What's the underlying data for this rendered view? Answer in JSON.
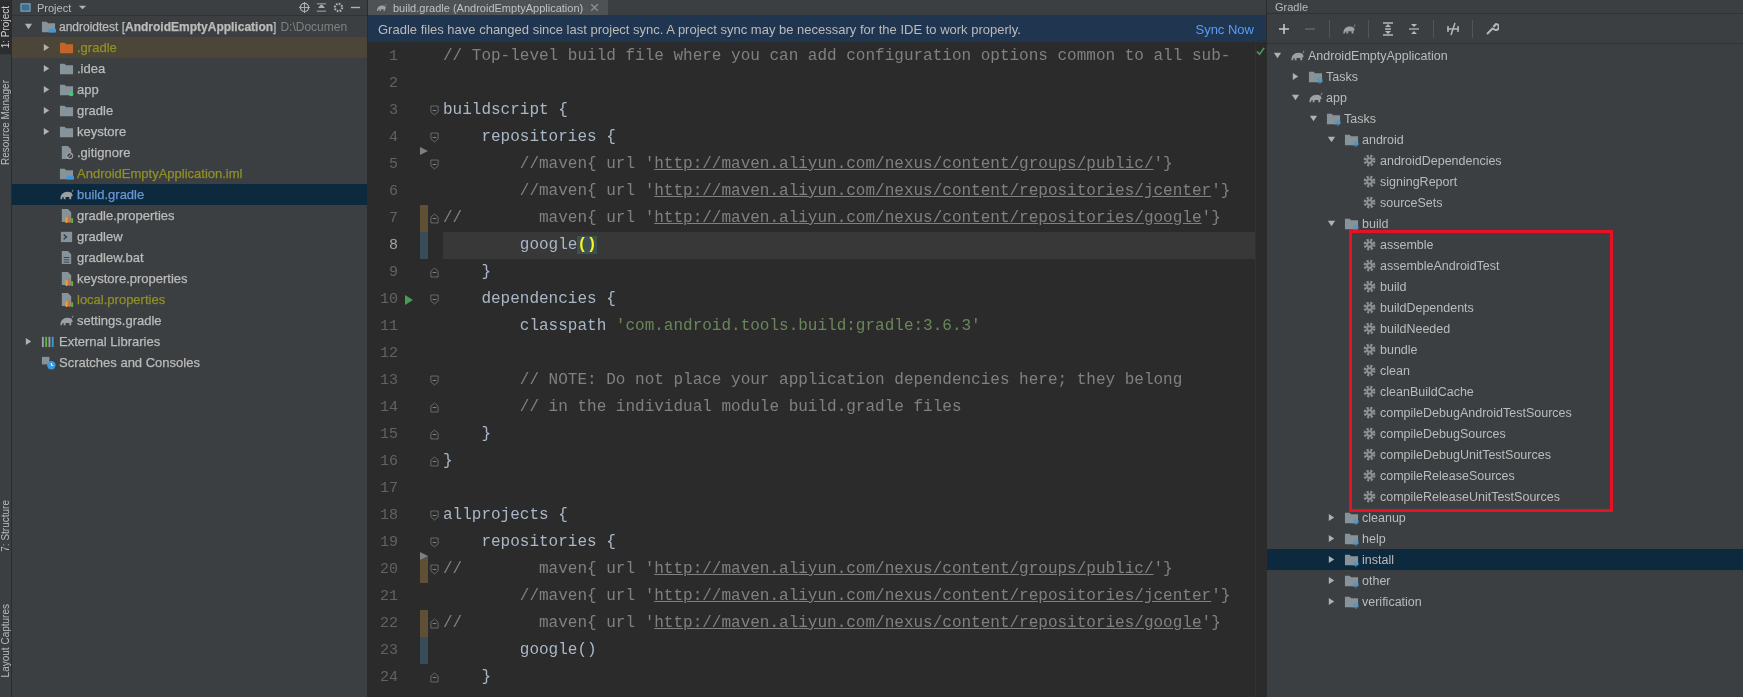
{
  "tool_stripe": {
    "top": [
      {
        "label": "1: Project",
        "selected": true
      },
      {
        "label": "Resource Manager",
        "selected": false
      }
    ],
    "bottom": [
      {
        "label": "7: Structure",
        "selected": false
      },
      {
        "label": "Layout Captures",
        "selected": false
      }
    ]
  },
  "project": {
    "title": "Project",
    "tree": [
      {
        "label": "androidtest [**AndroidEmptyApplication**]",
        "location": "D:\\Documen",
        "kind": "project-root",
        "color": "#bbbbbb",
        "selected": false,
        "expanded": true,
        "children": [
          {
            "label": ".gradle",
            "kind": "excluded-folder",
            "color": "#8f9027",
            "selected": false,
            "highlighted": true,
            "expanded": false
          },
          {
            "label": ".idea",
            "kind": "folder",
            "color": "#bbbbbb",
            "selected": false,
            "expanded": false
          },
          {
            "label": "app",
            "kind": "module-folder",
            "color": "#bbbbbb",
            "selected": false,
            "expanded": false
          },
          {
            "label": "gradle",
            "kind": "folder",
            "color": "#bbbbbb",
            "selected": false,
            "expanded": false
          },
          {
            "label": "keystore",
            "kind": "folder",
            "color": "#bbbbbb",
            "selected": false,
            "expanded": false
          },
          {
            "label": ".gitignore",
            "kind": "ignore-file",
            "color": "#bbbbbb",
            "selected": false
          },
          {
            "label": "AndroidEmptyApplication.iml",
            "kind": "module-file",
            "color": "#8f9027",
            "selected": false
          },
          {
            "label": "build.gradle",
            "kind": "gradle-file",
            "color": "#6897d0",
            "selected": true
          },
          {
            "label": "gradle.properties",
            "kind": "properties-file",
            "color": "#bbbbbb",
            "selected": false
          },
          {
            "label": "gradlew",
            "kind": "script-file",
            "color": "#bbbbbb",
            "selected": false
          },
          {
            "label": "gradlew.bat",
            "kind": "text-file",
            "color": "#bbbbbb",
            "selected": false
          },
          {
            "label": "keystore.properties",
            "kind": "properties-file",
            "color": "#bbbbbb",
            "selected": false
          },
          {
            "label": "local.properties",
            "kind": "properties-file",
            "color": "#8f9027",
            "selected": false
          },
          {
            "label": "settings.gradle",
            "kind": "gradle-file",
            "color": "#bbbbbb",
            "selected": false
          }
        ]
      },
      {
        "label": "External Libraries",
        "kind": "libraries",
        "color": "#bbbbbb",
        "selected": false,
        "expanded": false
      },
      {
        "label": "Scratches and Consoles",
        "kind": "scratches",
        "color": "#bbbbbb",
        "selected": false
      }
    ]
  },
  "editor": {
    "tab": {
      "label": "build.gradle (AndroidEmptyApplication)",
      "selected": true
    },
    "notification": {
      "message": "Gradle files have changed since last project sync. A project sync may be necessary for the IDE to work properly.",
      "action": "Sync Now"
    },
    "lines": [
      {
        "number": "1",
        "tokens": [
          {
            "text": "// Top-level build file where you can add configuration options common to all sub-",
            "kind": "comment"
          }
        ]
      },
      {
        "number": "2"
      },
      {
        "number": "3",
        "fold_start": true,
        "tokens": [
          {
            "text": "buildscript {",
            "kind": "plain"
          }
        ]
      },
      {
        "number": "4",
        "fold_start": true,
        "tokens": [
          {
            "text": "    repositories {",
            "kind": "plain"
          }
        ]
      },
      {
        "number": "5",
        "fold_start": true,
        "deleted_above": true,
        "tokens": [
          {
            "text": "        //maven{ url '",
            "kind": "comment"
          },
          {
            "text": "http://maven.aliyun.com/nexus/content/groups/public/",
            "kind": "link"
          },
          {
            "text": "'}",
            "kind": "comment"
          }
        ]
      },
      {
        "number": "6",
        "tokens": [
          {
            "text": "        //maven{ url '",
            "kind": "comment"
          },
          {
            "text": "http://maven.aliyun.com/nexus/content/repositories/jcenter",
            "kind": "link"
          },
          {
            "text": "'}",
            "kind": "comment"
          }
        ]
      },
      {
        "number": "7",
        "fold_end": true,
        "modified": true,
        "tokens": [
          {
            "text": "//        maven{ url '",
            "kind": "comment"
          },
          {
            "text": "http://maven.aliyun.com/nexus/content/repositories/google",
            "kind": "link"
          },
          {
            "text": "'}",
            "kind": "comment"
          }
        ]
      },
      {
        "number": "8",
        "current": true,
        "added": true,
        "tokens": [
          {
            "text": "        google",
            "kind": "plain"
          },
          {
            "text": "()",
            "kind": "match"
          }
        ]
      },
      {
        "number": "9",
        "fold_end": true,
        "tokens": [
          {
            "text": "    }",
            "kind": "plain"
          }
        ]
      },
      {
        "number": "10",
        "fold_start": true,
        "run": true,
        "tokens": [
          {
            "text": "    dependencies {",
            "kind": "plain"
          }
        ]
      },
      {
        "number": "11",
        "tokens": [
          {
            "text": "        classpath ",
            "kind": "plain"
          },
          {
            "text": "'com.android.tools.build:gradle:3.6.3'",
            "kind": "string"
          }
        ]
      },
      {
        "number": "12"
      },
      {
        "number": "13",
        "fold_start": true,
        "tokens": [
          {
            "text": "        // NOTE: Do not place your application dependencies here; they belong",
            "kind": "comment"
          }
        ]
      },
      {
        "number": "14",
        "fold_end": true,
        "tokens": [
          {
            "text": "        // in the individual module build.gradle files",
            "kind": "comment"
          }
        ]
      },
      {
        "number": "15",
        "fold_end": true,
        "tokens": [
          {
            "text": "    }",
            "kind": "plain"
          }
        ]
      },
      {
        "number": "16",
        "fold_end": true,
        "tokens": [
          {
            "text": "}",
            "kind": "plain"
          }
        ]
      },
      {
        "number": "17"
      },
      {
        "number": "18",
        "fold_start": true,
        "tokens": [
          {
            "text": "allprojects {",
            "kind": "plain"
          }
        ]
      },
      {
        "number": "19",
        "fold_start": true,
        "tokens": [
          {
            "text": "    repositories {",
            "kind": "plain"
          }
        ]
      },
      {
        "number": "20",
        "fold_start": true,
        "modified": true,
        "deleted_above": true,
        "tokens": [
          {
            "text": "//        maven{ url '",
            "kind": "comment"
          },
          {
            "text": "http://maven.aliyun.com/nexus/content/groups/public/",
            "kind": "link"
          },
          {
            "text": "'}",
            "kind": "comment"
          }
        ]
      },
      {
        "number": "21",
        "tokens": [
          {
            "text": "        //maven{ url '",
            "kind": "comment"
          },
          {
            "text": "http://maven.aliyun.com/nexus/content/repositories/jcenter",
            "kind": "link"
          },
          {
            "text": "'}",
            "kind": "comment"
          }
        ]
      },
      {
        "number": "22",
        "fold_end": true,
        "modified": true,
        "tokens": [
          {
            "text": "//        maven{ url '",
            "kind": "comment"
          },
          {
            "text": "http://maven.aliyun.com/nexus/content/repositories/google",
            "kind": "link"
          },
          {
            "text": "'}",
            "kind": "comment"
          }
        ]
      },
      {
        "number": "23",
        "added": true,
        "tokens": [
          {
            "text": "        google()",
            "kind": "plain"
          }
        ]
      },
      {
        "number": "24",
        "fold_end": true,
        "tokens": [
          {
            "text": "    }",
            "kind": "plain"
          }
        ]
      }
    ]
  },
  "gradle": {
    "title": "Gradle",
    "tree": [
      {
        "label": "AndroidEmptyApplication",
        "kind": "elephant",
        "selected": false,
        "expanded": true,
        "children": [
          {
            "label": "Tasks",
            "kind": "task-folder",
            "selected": false,
            "expanded": false
          },
          {
            "label": "app",
            "kind": "elephant",
            "selected": false,
            "expanded": true,
            "children": [
              {
                "label": "Tasks",
                "kind": "task-folder",
                "selected": false,
                "expanded": true,
                "children": [
                  {
                    "label": "android",
                    "kind": "task-folder",
                    "selected": false,
                    "expanded": true,
                    "children": [
                      {
                        "label": "androidDependencies",
                        "kind": "gear",
                        "selected": false
                      },
                      {
                        "label": "signingReport",
                        "kind": "gear",
                        "selected": false
                      },
                      {
                        "label": "sourceSets",
                        "kind": "gear",
                        "selected": false
                      }
                    ]
                  },
                  {
                    "label": "build",
                    "kind": "task-folder",
                    "selected": false,
                    "expanded": true,
                    "annotated": true,
                    "children": [
                      {
                        "label": "assemble",
                        "kind": "gear",
                        "selected": false
                      },
                      {
                        "label": "assembleAndroidTest",
                        "kind": "gear",
                        "selected": false
                      },
                      {
                        "label": "build",
                        "kind": "gear",
                        "selected": false
                      },
                      {
                        "label": "buildDependents",
                        "kind": "gear",
                        "selected": false
                      },
                      {
                        "label": "buildNeeded",
                        "kind": "gear",
                        "selected": false
                      },
                      {
                        "label": "bundle",
                        "kind": "gear",
                        "selected": false
                      },
                      {
                        "label": "clean",
                        "kind": "gear",
                        "selected": false
                      },
                      {
                        "label": "cleanBuildCache",
                        "kind": "gear",
                        "selected": false
                      },
                      {
                        "label": "compileDebugAndroidTestSources",
                        "kind": "gear",
                        "selected": false
                      },
                      {
                        "label": "compileDebugSources",
                        "kind": "gear",
                        "selected": false
                      },
                      {
                        "label": "compileDebugUnitTestSources",
                        "kind": "gear",
                        "selected": false
                      },
                      {
                        "label": "compileReleaseSources",
                        "kind": "gear",
                        "selected": false
                      },
                      {
                        "label": "compileReleaseUnitTestSources",
                        "kind": "gear",
                        "selected": false
                      }
                    ]
                  },
                  {
                    "label": "cleanup",
                    "kind": "task-folder",
                    "selected": false,
                    "expanded": false
                  },
                  {
                    "label": "help",
                    "kind": "task-folder",
                    "selected": false,
                    "expanded": false
                  },
                  {
                    "label": "install",
                    "kind": "task-folder",
                    "selected": true,
                    "expanded": false
                  },
                  {
                    "label": "other",
                    "kind": "task-folder",
                    "selected": false,
                    "expanded": false
                  },
                  {
                    "label": "verification",
                    "kind": "task-folder",
                    "selected": false,
                    "expanded": false
                  }
                ]
              }
            ]
          }
        ]
      }
    ]
  }
}
